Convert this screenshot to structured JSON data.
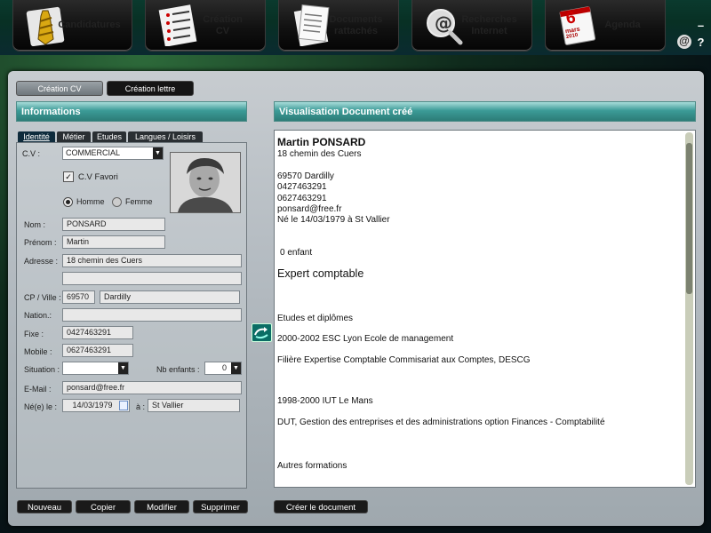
{
  "nav": [
    {
      "label": "Candidatures",
      "icon": "tie-icon"
    },
    {
      "label": "Création\nCV",
      "icon": "checklist-icon"
    },
    {
      "label": "Documents\nrattachés",
      "icon": "document-icon"
    },
    {
      "label": "Recherches\nInternet",
      "icon": "magnifier-icon"
    },
    {
      "label": "Agenda",
      "icon": "calendar-icon",
      "cal_day": "6",
      "cal_month": "mars",
      "cal_year": "2010"
    }
  ],
  "side": {
    "minimize": "–",
    "help": "?"
  },
  "tabs": {
    "cv": "Création CV",
    "letter": "Création lettre"
  },
  "info_header": "Informations",
  "doc_header": "Visualisation Document créé",
  "subtabs": [
    "Identité",
    "Métier",
    "Etudes",
    "Langues / Loisirs"
  ],
  "form": {
    "cv_label": "C.V :",
    "cv_value": "COMMERCIAL",
    "favori_label": "C.V Favori",
    "homme_label": "Homme",
    "femme_label": "Femme",
    "nom_label": "Nom :",
    "nom": "PONSARD",
    "prenom_label": "Prénom :",
    "prenom": "Martin",
    "adresse_label": "Adresse :",
    "adresse": "18 chemin des Cuers",
    "adresse2": "",
    "cp_label": "CP / Ville :",
    "cp": "69570",
    "ville": "Dardilly",
    "nation_label": "Nation.:",
    "nation": "",
    "fixe_label": "Fixe :",
    "fixe": "0427463291",
    "mobile_label": "Mobile :",
    "mobile": "0627463291",
    "situation_label": "Situation :",
    "situation": "",
    "nb_enfants_label": "Nb enfants :",
    "nb_enfants": "0",
    "email_label": "E-Mail :",
    "email": "ponsard@free.fr",
    "ne_label": "Né(e) le :",
    "ne_date": "14/03/1979",
    "a_label": "à :",
    "ne_lieu": "St Vallier"
  },
  "document": {
    "name": "Martin PONSARD",
    "lines": [
      "18 chemin des Cuers",
      "69570 Dardilly",
      "0427463291",
      "0627463291",
      "ponsard@free.fr",
      "Né le 14/03/1979 à St Vallier",
      "0 enfant",
      "Expert comptable",
      "Etudes et diplômes",
      "2000-2002 ESC Lyon  Ecole de management",
      "Filière Expertise Comptable Commisariat aux Comptes, DESCG",
      "1998-2000 IUT Le Mans",
      "DUT, Gestion des entreprises et des administrations option Finances - Comptabilité",
      "Autres formations"
    ]
  },
  "buttons": {
    "nouveau": "Nouveau",
    "copier": "Copier",
    "modifier": "Modifier",
    "supprimer": "Supprimer",
    "creer": "Créer le document"
  }
}
